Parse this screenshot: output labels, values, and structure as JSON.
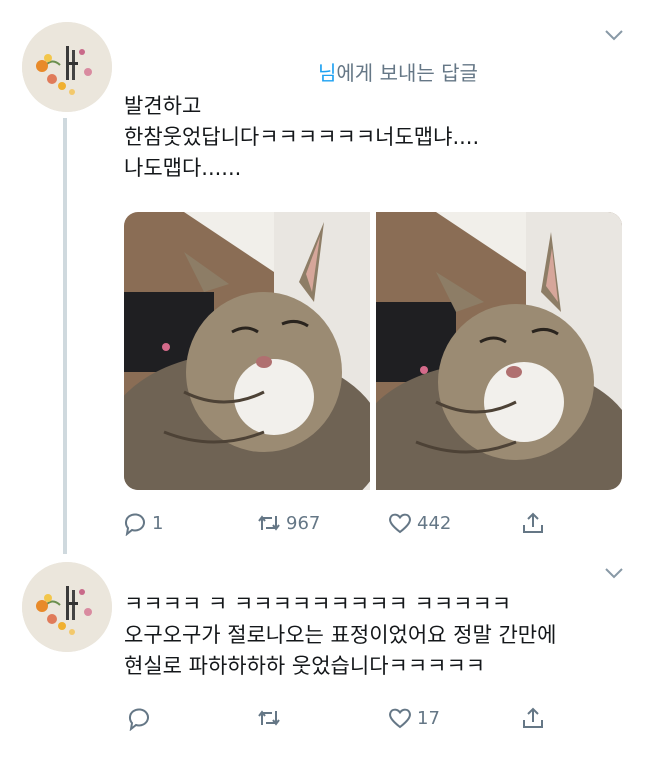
{
  "tweet1": {
    "reply_user": "님",
    "reply_suffix": "에게 보내는 답글",
    "text": "발견하고\n한참웃었답니다ㅋㅋㅋㅋㅋㅋ너도맵냐....\n나도맵다......",
    "photos": [
      "cat-photo-1",
      "cat-photo-2"
    ],
    "actions": {
      "reply_count": "1",
      "retweet_count": "967",
      "like_count": "442"
    }
  },
  "tweet2": {
    "text": "ㅋㅋㅋㅋ ㅋ ㅋㅋㅋㅋㅋㅋㅋㅋㅋ ㅋㅋㅋㅋㅋ\n오구오구가 절로나오는 표정이었어요 정말 간만에\n현실로 파하하하하 웃었습니다ㅋㅋㅋㅋㅋ",
    "actions": {
      "reply_count": "",
      "retweet_count": "",
      "like_count": "17"
    }
  },
  "icons": [
    "caret-down-icon",
    "reply-icon",
    "retweet-icon",
    "like-icon",
    "share-icon"
  ],
  "colors": {
    "link": "#1da1f2",
    "muted": "#657786",
    "text": "#14171a",
    "thread": "#cfd9de"
  }
}
